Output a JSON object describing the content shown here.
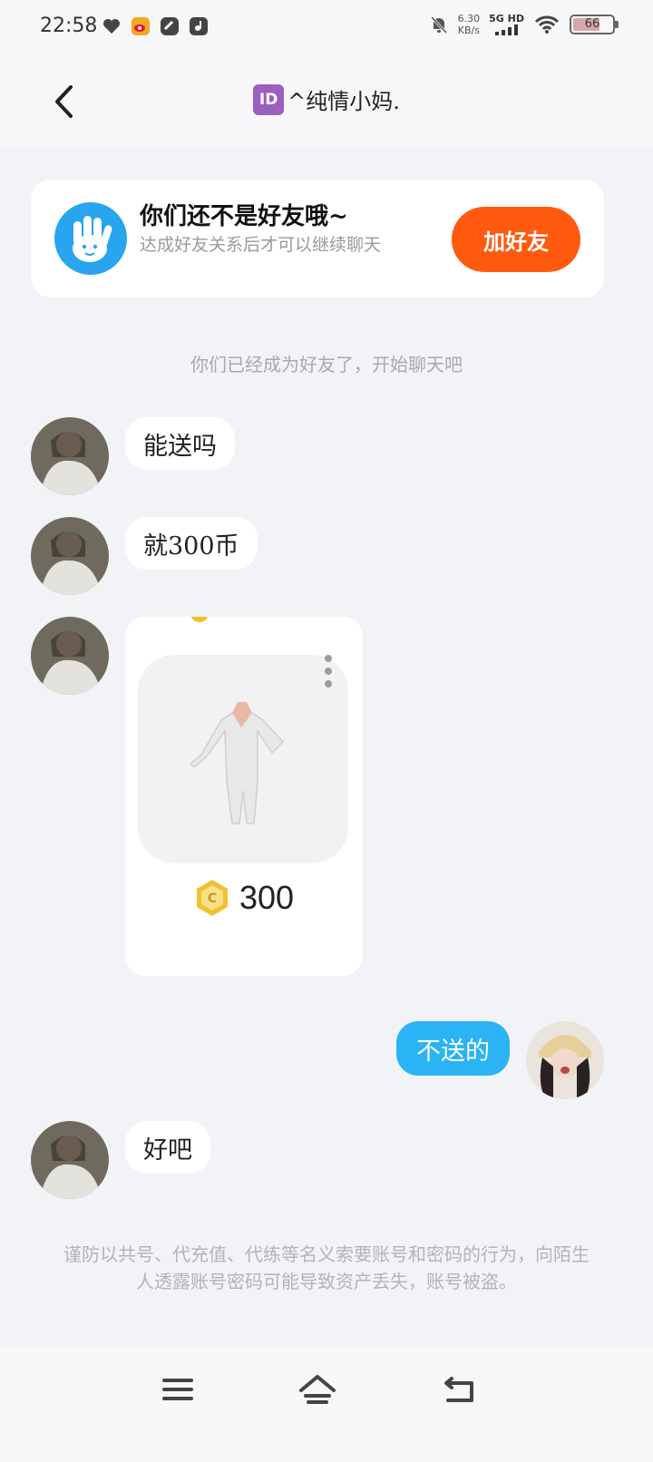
{
  "status_bar": {
    "time": "22:58",
    "speed_value": "6.30",
    "speed_unit": "KB/s",
    "network": "5G HD",
    "battery": "66"
  },
  "header": {
    "id_badge": "ID",
    "title": "^纯情小妈."
  },
  "friend_card": {
    "title": "你们还不是好友哦~",
    "subtitle": "达成好友关系后才可以继续聊天",
    "add_button": "加好友"
  },
  "system_notice": "你们已经成为好友了，开始聊天吧",
  "messages": [
    {
      "side": "in",
      "text": "能送吗"
    },
    {
      "side": "in",
      "text": "就300币"
    },
    {
      "side": "in",
      "type": "gift",
      "price": "300"
    },
    {
      "side": "out",
      "text": "不送的"
    },
    {
      "side": "in",
      "text": "好吧"
    }
  ],
  "warning": "谨防以共号、代充值、代练等名义索要账号和密码的行为，向陌生人透露账号密码可能导致资产丢失，账号被盗。",
  "colors": {
    "accent_blue": "#2ab3f5",
    "add_friend_orange": "#ff5a0f",
    "coin_gold": "#f2c12e"
  },
  "icons": [
    "back-icon",
    "hand-icon",
    "coin-icon",
    "menu-icon",
    "home-icon",
    "return-icon",
    "bell-off-icon",
    "wifi-icon"
  ]
}
